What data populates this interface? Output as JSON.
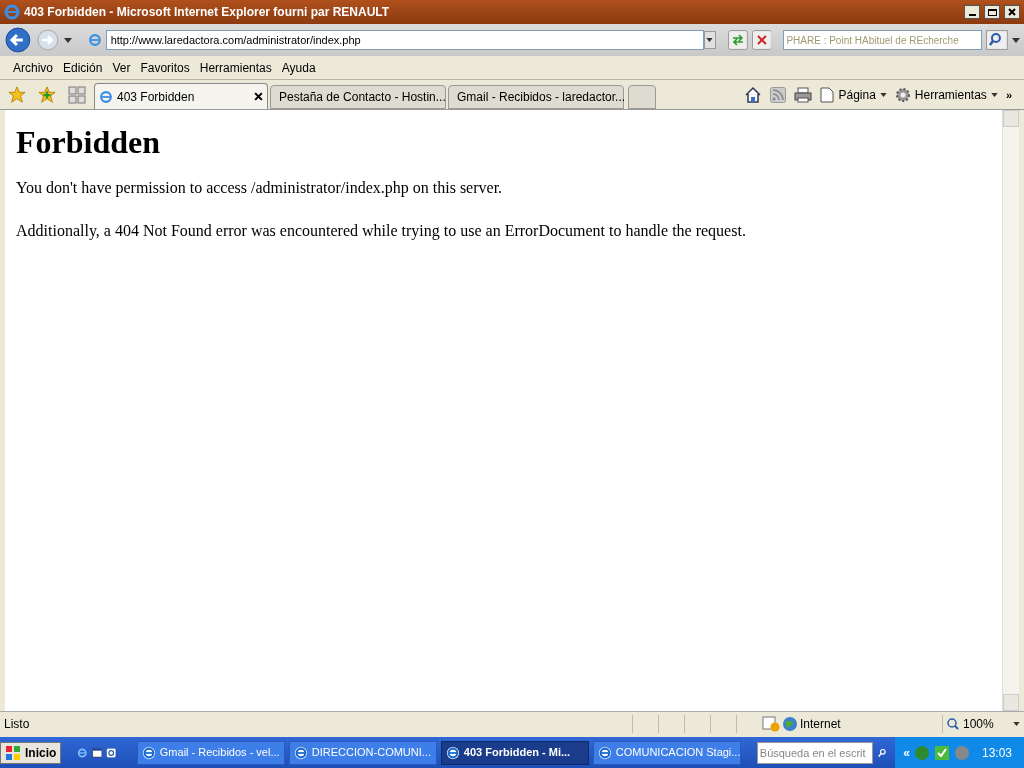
{
  "window": {
    "title": "403 Forbidden - Microsoft Internet Explorer fourni par RENAULT"
  },
  "address_bar": {
    "value": "http://www.laredactora.com/administrator/index.php",
    "search_placeholder": "PHARE : Point HAbituel de REcherche"
  },
  "menu": [
    "Archivo",
    "Edición",
    "Ver",
    "Favoritos",
    "Herramientas",
    "Ayuda"
  ],
  "tabs": [
    {
      "label": "403 Forbidden",
      "selected": true
    },
    {
      "label": "Pestaña de Contacto - Hostin...",
      "selected": false
    },
    {
      "label": "Gmail - Recibidos - laredactor...",
      "selected": false
    }
  ],
  "command_bar": {
    "page": "Página",
    "tools": "Herramientas",
    "more": "»"
  },
  "content": {
    "heading": "Forbidden",
    "paragraphs": [
      "You don't have permission to access /administrator/index.php on this server.",
      "Additionally, a 404 Not Found error was encountered while trying to use an ErrorDocument to handle the request."
    ]
  },
  "status_bar": {
    "text": "Listo",
    "zone": "Internet",
    "zoom": "100%"
  },
  "taskbar": {
    "start": "Inicio",
    "tasks": [
      {
        "label": "Gmail - Recibidos - vel...",
        "selected": false
      },
      {
        "label": "DIRECCION-COMUNI...",
        "selected": false
      },
      {
        "label": "403 Forbidden - Mi...",
        "selected": true
      },
      {
        "label": "COMUNICACION Stagi...",
        "selected": false
      }
    ],
    "search_placeholder": "Búsqueda en el escrit",
    "tray_expand": "«",
    "clock": "13:03"
  }
}
